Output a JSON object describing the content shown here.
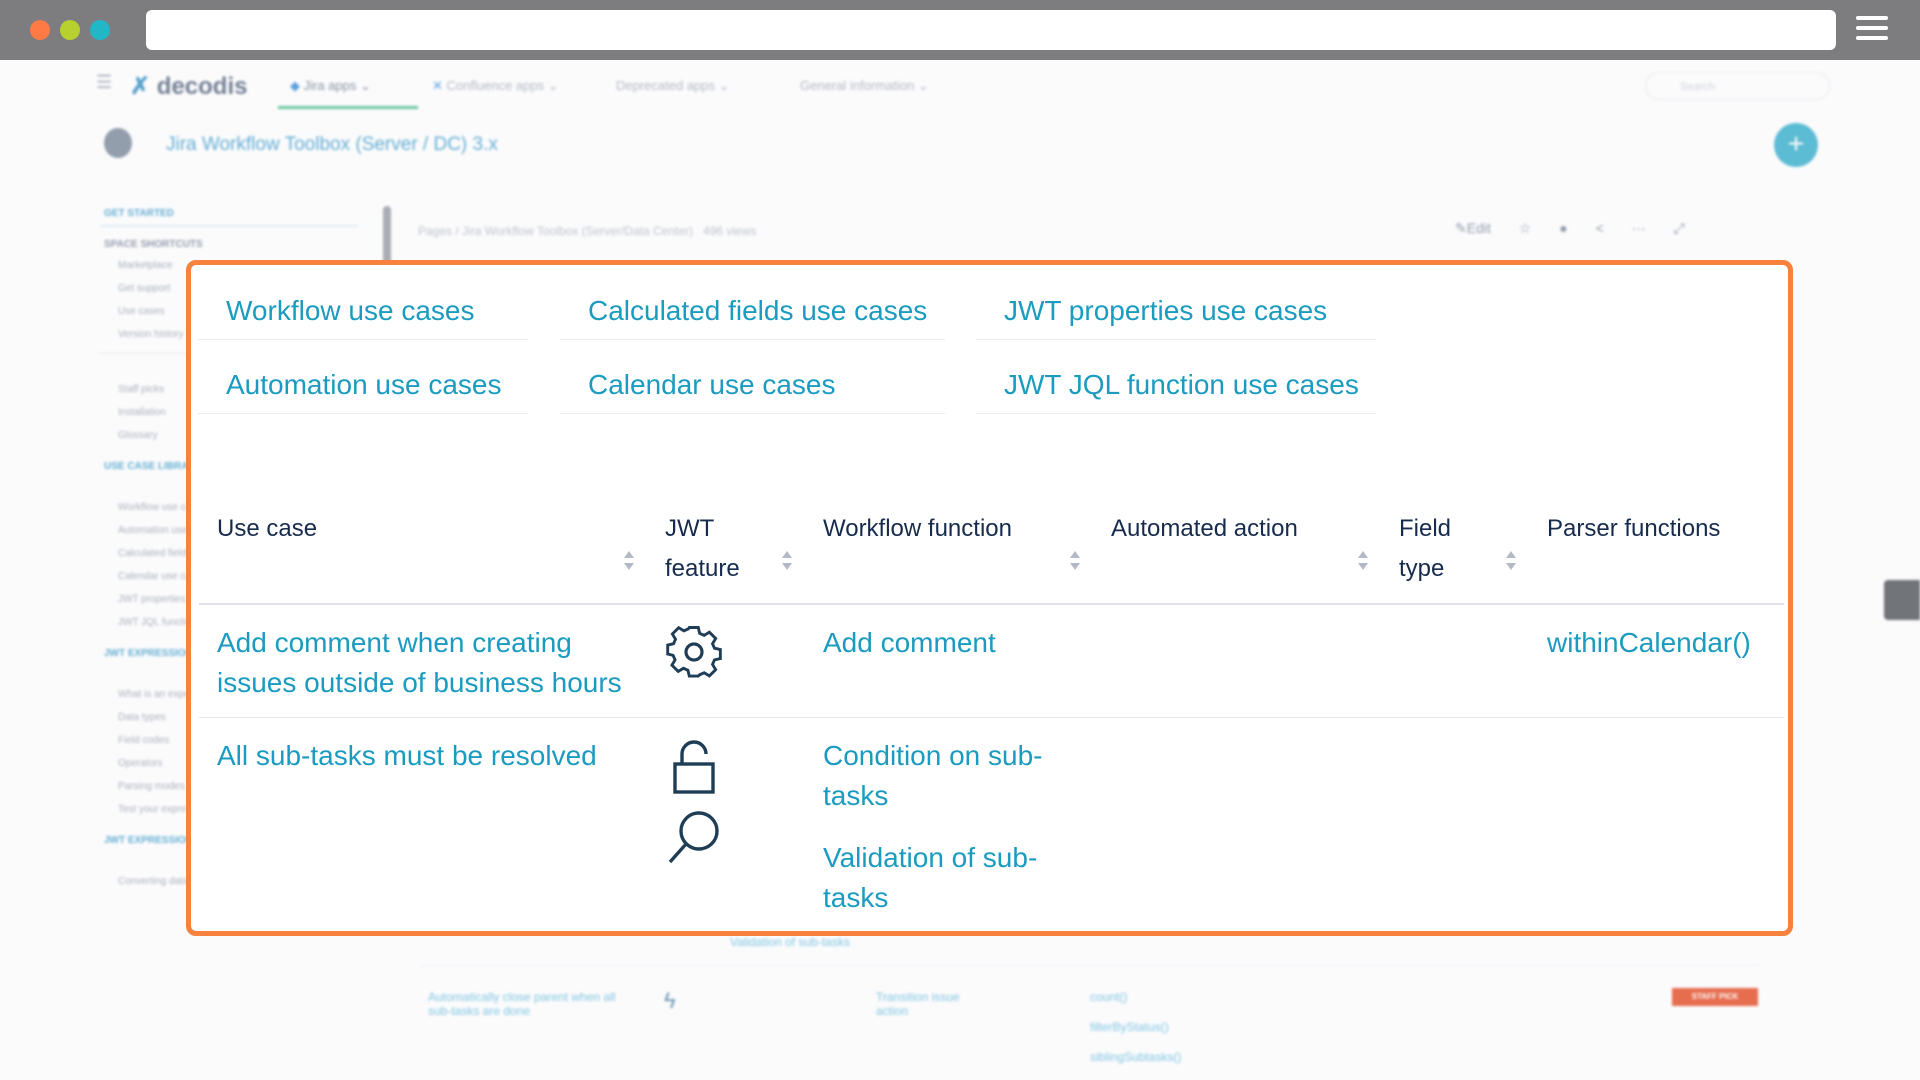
{
  "browser": {
    "dots": [
      "#ff7a45",
      "#b9d12e",
      "#21b7c7"
    ]
  },
  "nav": {
    "brand": "decodis",
    "items": [
      "Jira apps",
      "Confluence apps",
      "Deprecated apps",
      "General information"
    ],
    "search_placeholder": "Search"
  },
  "space": {
    "title": "Jira Workflow Toolbox (Server / DC) 3.x"
  },
  "sidebar": {
    "get_started": "GET STARTED",
    "shortcuts_title": "SPACE SHORTCUTS",
    "shortcuts": [
      "Marketplace",
      "Get support",
      "Use cases",
      "Version history"
    ],
    "top_items": [
      "Staff picks",
      "Installation",
      "Glossary"
    ],
    "use_case_library": "USE CASE LIBRARY",
    "use_case_items": [
      "Workflow use cases",
      "Automation use cases",
      "Calculated fields use cases",
      "Calendar use cases",
      "JWT properties use cases",
      "JWT JQL function use cases"
    ],
    "jwt_expression": "JWT EXPRESSION EDITOR",
    "expression_items": [
      "What is an expression",
      "Data types",
      "Field codes",
      "Operators",
      "Parsing modes",
      "Test your expression"
    ],
    "parser_functions": "JWT EXPRESSION PARSER FUNCTIONS",
    "parser_items": [
      "Converting data types"
    ]
  },
  "page": {
    "breadcrumb": "Pages / Jira Workflow Toolbox (Server/Data Center)",
    "views": "496 views",
    "edit_label": "Edit"
  },
  "links": [
    [
      "Workflow use cases",
      "Calculated fields use cases",
      "JWT properties use cases"
    ],
    [
      "Automation use cases",
      "Calendar use cases",
      "JWT JQL function use cases"
    ]
  ],
  "table": {
    "headers": [
      "Use case",
      "JWT feature",
      "Workflow function",
      "Automated action",
      "Field type",
      "Parser functions"
    ],
    "rows": [
      {
        "use_case": "Add comment when creating issues outside of business hours",
        "feature_icons": [
          "gear-icon"
        ],
        "workflow_functions": [
          "Add comment"
        ],
        "automated_action": "",
        "field_type": "",
        "parser_functions": "withinCalendar()"
      },
      {
        "use_case": "All sub-tasks must be resolved",
        "feature_icons": [
          "lock-icon",
          "search-icon"
        ],
        "workflow_functions": [
          "Condition on sub-tasks",
          "Validation of sub-tasks"
        ],
        "automated_action": "",
        "field_type": "",
        "parser_functions": ""
      }
    ]
  },
  "below": {
    "row_partial": "Validation of sub-tasks",
    "row_use_case": "Automatically close parent when all sub-tasks are done",
    "row_workflow": "Transition issue action",
    "row_parser": [
      "count()",
      "filterByStatus()",
      "siblingSubtasks()"
    ],
    "staff_pick": "STAFF PICK"
  }
}
